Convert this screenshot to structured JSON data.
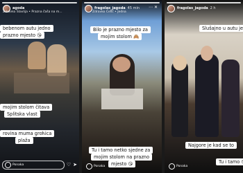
{
  "stories": [
    {
      "user": "agoda",
      "location": "Zdravko Slavlija • Prazna čaša na m...",
      "captions": [
        "bebenom autu jedno",
        "prazno mjesto 😘",
        "mojim stolom čitava",
        "Splitska vlast",
        "rovina muma groћica",
        "plaža"
      ],
      "reply_placeholder": "Ponaka"
    },
    {
      "user": "fragolas_jagoda",
      "time": "45 min",
      "location": "Zdravko Čelić • Jedna",
      "captions": [
        "Bilo je prazno mjesto za",
        "mojim stolom 🙈",
        "Tu i tamo netko sjedne za",
        "mojim stolom na prazno",
        "mjesto 😘"
      ],
      "reply_placeholder": "Ponaka"
    },
    {
      "user": "fragolas_jagoda",
      "time": "2 h",
      "captions": [
        "Slušajno u autu jedno",
        "Najgore je kad se to",
        "Tu i tamo 😘"
      ],
      "reply_placeholder": "Ponaka"
    }
  ],
  "icons": {
    "more": "more-icon",
    "close": "close-icon",
    "like": "heart-icon",
    "send": "send-icon",
    "camera": "camera-icon"
  }
}
